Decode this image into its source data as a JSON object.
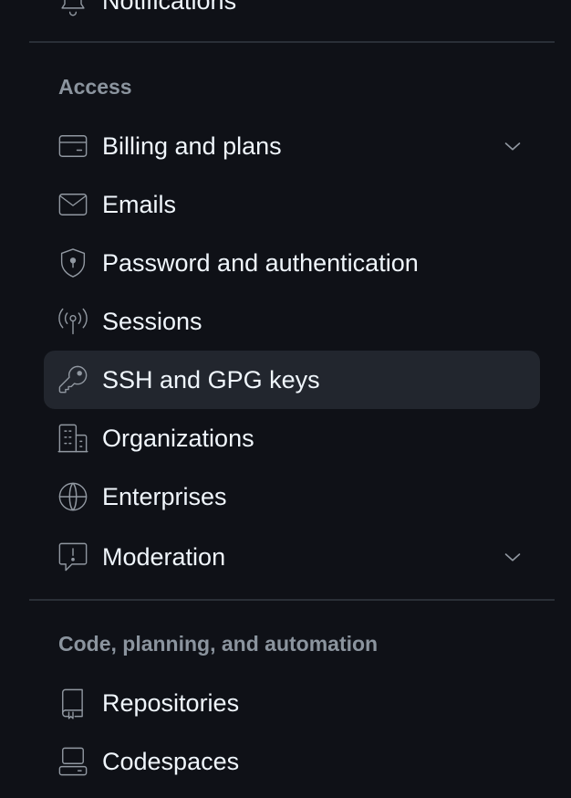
{
  "top_item": {
    "label": "Notifications",
    "icon": "bell-icon"
  },
  "sections": [
    {
      "heading": "Access",
      "items": [
        {
          "label": "Billing and plans",
          "icon": "credit-card-icon",
          "expandable": true
        },
        {
          "label": "Emails",
          "icon": "mail-icon"
        },
        {
          "label": "Password and authentication",
          "icon": "shield-lock-icon"
        },
        {
          "label": "Sessions",
          "icon": "broadcast-icon"
        },
        {
          "label": "SSH and GPG keys",
          "icon": "key-icon",
          "selected": true
        },
        {
          "label": "Organizations",
          "icon": "organization-icon"
        },
        {
          "label": "Enterprises",
          "icon": "globe-icon"
        },
        {
          "label": "Moderation",
          "icon": "report-icon",
          "expandable": true
        }
      ]
    },
    {
      "heading": "Code, planning, and automation",
      "items": [
        {
          "label": "Repositories",
          "icon": "repo-icon"
        },
        {
          "label": "Codespaces",
          "icon": "codespaces-icon"
        }
      ]
    }
  ],
  "colors": {
    "background": "#0f1117",
    "selected_background": "#22262e",
    "text": "#f0f6fc",
    "muted_text": "#8b949e",
    "icon": "#9198a1",
    "divider": "#2a2f37"
  }
}
